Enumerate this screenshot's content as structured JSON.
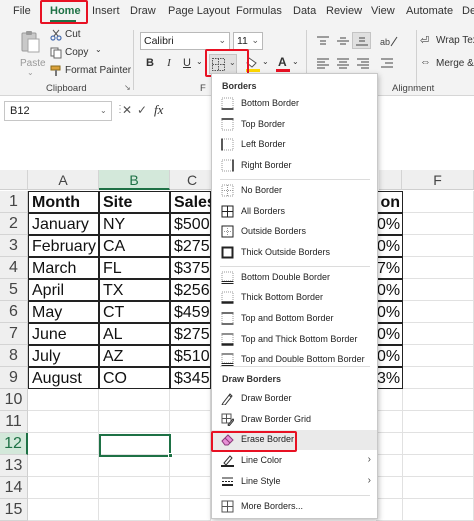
{
  "tabs": [
    "File",
    "Home",
    "Insert",
    "Draw",
    "Page Layout",
    "Formulas",
    "Data",
    "Review",
    "View",
    "Automate",
    "De"
  ],
  "active_tab": "Home",
  "clipboard": {
    "cut": "Cut",
    "copy": "Copy",
    "copy_arrow": "⌄",
    "format_painter": "Format Painter",
    "paste": "Paste",
    "paste_arrow": "⌄",
    "group_label": "Clipboard"
  },
  "font": {
    "name": "Calibri",
    "size": "11",
    "bold": "B",
    "italic": "I",
    "underline": "U",
    "group_label": "F"
  },
  "alignment": {
    "wrap_text": "Wrap Tex",
    "merge": "Merge &",
    "group_label": "Alignment"
  },
  "formula_bar": {
    "name_box": "B12",
    "fx": "fx"
  },
  "grid": {
    "columns": [
      "A",
      "B",
      "C",
      "F"
    ],
    "rows": [
      "1",
      "2",
      "3",
      "4",
      "5",
      "6",
      "7",
      "8",
      "9",
      "10",
      "11",
      "12",
      "13",
      "14",
      "15"
    ],
    "selected_column": "B",
    "selected_row": "12",
    "headers": {
      "month": "Month",
      "site": "Site",
      "sales": "Sales",
      "partial": "on"
    },
    "data": [
      {
        "month": "January",
        "site": "NY",
        "sales": "$500,",
        "pct": "0%"
      },
      {
        "month": "February",
        "site": "CA",
        "sales": "$275,",
        "pct": "0%"
      },
      {
        "month": "March",
        "site": "FL",
        "sales": "$375,",
        "pct": "7%"
      },
      {
        "month": "April",
        "site": "TX",
        "sales": "$256,",
        "pct": "0%"
      },
      {
        "month": "May",
        "site": "CT",
        "sales": "$459,",
        "pct": "0%"
      },
      {
        "month": "June",
        "site": "AL",
        "sales": "$275,",
        "pct": "0%"
      },
      {
        "month": "July",
        "site": "AZ",
        "sales": "$510,",
        "pct": "0%"
      },
      {
        "month": "August",
        "site": "CO",
        "sales": "$345,",
        "pct": "3%"
      }
    ]
  },
  "border_menu": {
    "section_borders": "Borders",
    "section_draw": "Draw Borders",
    "items": [
      {
        "label": "Bottom Border",
        "icon": "bottom-border-icon"
      },
      {
        "label": "Top Border",
        "icon": "top-border-icon"
      },
      {
        "label": "Left Border",
        "icon": "left-border-icon"
      },
      {
        "label": "Right Border",
        "icon": "right-border-icon"
      },
      {
        "label": "No Border",
        "icon": "no-border-icon"
      },
      {
        "label": "All Borders",
        "icon": "all-borders-icon"
      },
      {
        "label": "Outside Borders",
        "icon": "outside-borders-icon"
      },
      {
        "label": "Thick Outside Borders",
        "icon": "thick-outside-borders-icon"
      },
      {
        "label": "Bottom Double Border",
        "icon": "bottom-double-border-icon"
      },
      {
        "label": "Thick Bottom Border",
        "icon": "thick-bottom-border-icon"
      },
      {
        "label": "Top and Bottom Border",
        "icon": "top-bottom-border-icon"
      },
      {
        "label": "Top and Thick Bottom Border",
        "icon": "top-thick-bottom-border-icon"
      },
      {
        "label": "Top and Double Bottom Border",
        "icon": "top-double-bottom-border-icon"
      }
    ],
    "draw_items": [
      {
        "label": "Draw Border",
        "icon": "draw-border-pencil-icon"
      },
      {
        "label": "Draw Border Grid",
        "icon": "draw-border-grid-icon"
      },
      {
        "label": "Erase Border",
        "icon": "eraser-icon"
      },
      {
        "label": "Line Color",
        "icon": "line-color-icon",
        "submenu": "›"
      },
      {
        "label": "Line Style",
        "icon": "line-style-icon",
        "submenu": "›"
      },
      {
        "label": "More Borders...",
        "icon": "more-borders-icon"
      }
    ]
  },
  "colors": {
    "accent": "#1e7145",
    "highlight_box": "#e81123",
    "font_color": "#e81123",
    "fill_color": "#ffd800"
  }
}
